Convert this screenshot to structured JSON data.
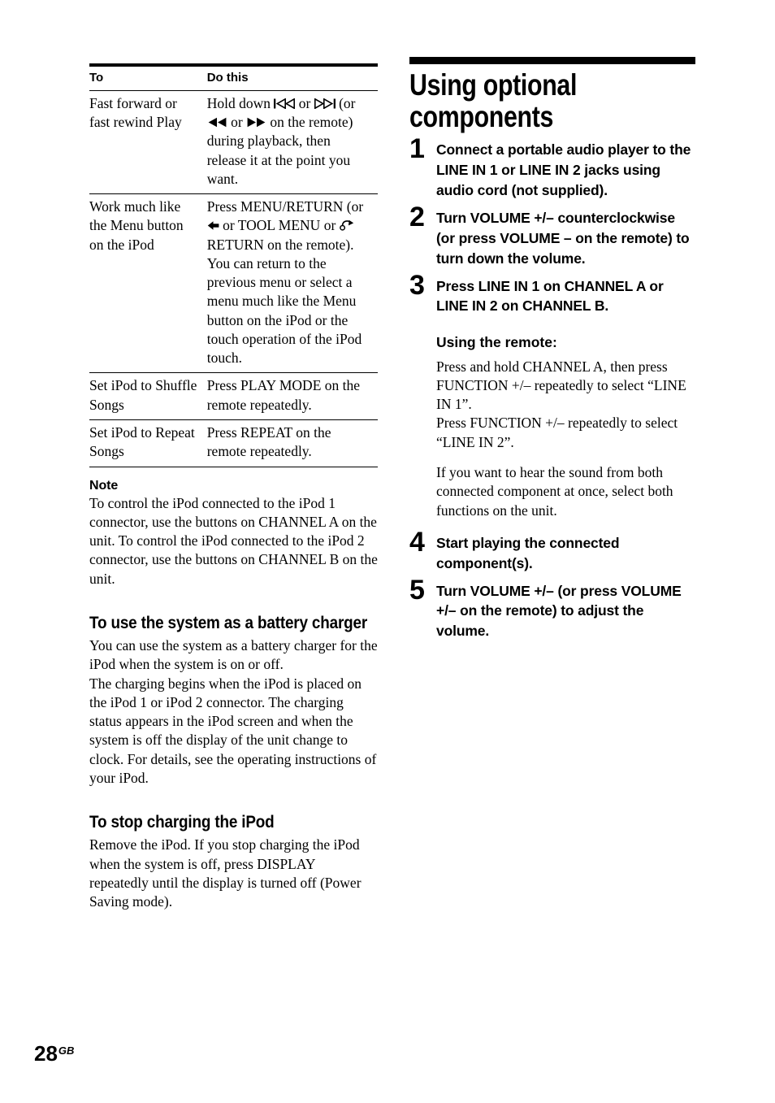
{
  "page": {
    "number": "28",
    "region_code": "GB"
  },
  "left_column": {
    "table": {
      "headers": [
        "To",
        "Do this"
      ],
      "rows": [
        {
          "to": "Fast forward or fast rewind Play",
          "do_prefix": "Hold down ",
          "do_icon1": "prev-track-icon",
          "do_mid1": " or ",
          "do_icon2": "next-track-icon",
          "do_mid2": " (or ",
          "do_icon3": "rewind-icon",
          "do_mid3": " or ",
          "do_icon4": "fast-forward-icon",
          "do_suffix": " on the remote) during playback, then release it at the point you want."
        },
        {
          "to": "Work much like the Menu button on the iPod",
          "do_prefix": "Press MENU/RETURN (or ",
          "do_icon1": "left-arrow-icon",
          "do_mid1": " or TOOL MENU or ",
          "do_icon2": "return-arrow-icon",
          "do_suffix": " RETURN on the remote). You can return to the previous menu or select a menu much like the Menu button on the iPod or the touch operation of the iPod touch."
        },
        {
          "to": "Set iPod to Shuffle Songs",
          "do": "Press PLAY MODE on the remote repeatedly."
        },
        {
          "to": "Set iPod to Repeat Songs",
          "do": "Press REPEAT on the remote repeatedly."
        }
      ]
    },
    "note": {
      "heading": "Note",
      "body": "To control the iPod connected to the iPod 1 connector, use the buttons on CHANNEL A on the unit. To control the iPod connected to the iPod 2 connector, use the buttons on CHANNEL B on the unit."
    },
    "battery_charger": {
      "heading": "To use the system as a battery charger",
      "body": "You can use the system as a battery charger for the iPod when the system is on or off.\nThe charging begins when the iPod is placed on the iPod 1 or iPod 2 connector. The charging status appears in the iPod screen and when the system is off the display of the unit change to clock. For details, see the operating instructions of your iPod."
    },
    "stop_charging": {
      "heading": "To stop charging the iPod",
      "body": "Remove the iPod. If you stop charging the iPod when the system is off, press DISPLAY repeatedly until the display is turned off (Power Saving mode)."
    }
  },
  "right_column": {
    "section_title": "Using optional components",
    "steps": [
      {
        "number": "1",
        "text": "Connect a portable audio player to the LINE IN 1 or LINE IN 2 jacks using audio cord (not supplied)."
      },
      {
        "number": "2",
        "text": "Turn VOLUME +/– counterclockwise (or press VOLUME – on the remote) to turn down the volume."
      },
      {
        "number": "3",
        "text": "Press LINE IN 1 on CHANNEL A or LINE IN 2 on CHANNEL B."
      },
      {
        "number": "4",
        "text": "Start playing the connected component(s)."
      },
      {
        "number": "5",
        "text": "Turn VOLUME +/– (or press VOLUME +/– on the remote) to adjust the volume."
      }
    ],
    "remote_section": {
      "heading": "Using the remote:",
      "paragraph1": "Press and hold CHANNEL A, then press FUNCTION +/– repeatedly to select “LINE IN 1”.\nPress FUNCTION +/– repeatedly to select “LINE IN 2”.",
      "paragraph2": "If you want to hear the sound from both connected component at once, select both functions on the unit."
    }
  }
}
